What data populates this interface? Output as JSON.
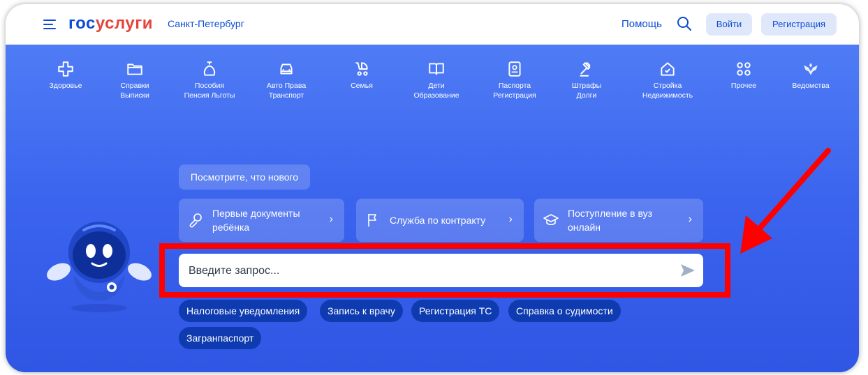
{
  "header": {
    "logo_part1": "гос",
    "logo_part2": "услуги",
    "city": "Санкт-Петербург",
    "help": "Помощь",
    "login": "Войти",
    "register": "Регистрация"
  },
  "categories": [
    {
      "label": "Здоровье",
      "icon": "health-cross-icon"
    },
    {
      "label": "Справки\nВыписки",
      "icon": "folder-icon"
    },
    {
      "label": "Пособия\nПенсия Льготы",
      "icon": "money-bag-icon"
    },
    {
      "label": "Авто Права\nТранспорт",
      "icon": "car-icon"
    },
    {
      "label": "Семья",
      "icon": "stroller-icon"
    },
    {
      "label": "Дети\nОбразование",
      "icon": "book-icon"
    },
    {
      "label": "Паспорта\nРегистрация",
      "icon": "passport-icon"
    },
    {
      "label": "Штрафы\nДолги",
      "icon": "gavel-icon"
    },
    {
      "label": "Стройка\nНедвижимость",
      "icon": "house-icon"
    },
    {
      "label": "Прочее",
      "icon": "grid-icon"
    },
    {
      "label": "Ведомства",
      "icon": "eagle-emblem-icon"
    }
  ],
  "whats_new": "Посмотрите, что нового",
  "cards": [
    {
      "label": "Первые документы\nребёнка",
      "icon": "baby-rattle-icon"
    },
    {
      "label": "Служба по контракту",
      "icon": "flag-icon"
    },
    {
      "label": "Поступление в вуз\nонлайн",
      "icon": "graduation-cap-icon"
    }
  ],
  "search": {
    "placeholder": "Введите запрос..."
  },
  "chips": [
    "Налоговые уведомления",
    "Запись к врачу",
    "Регистрация ТС",
    "Справка о судимости",
    "Загранпаспорт"
  ],
  "colors": {
    "brand_blue": "#0d4cd3",
    "brand_red": "#e4443b",
    "hero_blue": "#3a63ee",
    "chip_bg": "#0f3bb0",
    "annotation_red": "#ff0000"
  }
}
